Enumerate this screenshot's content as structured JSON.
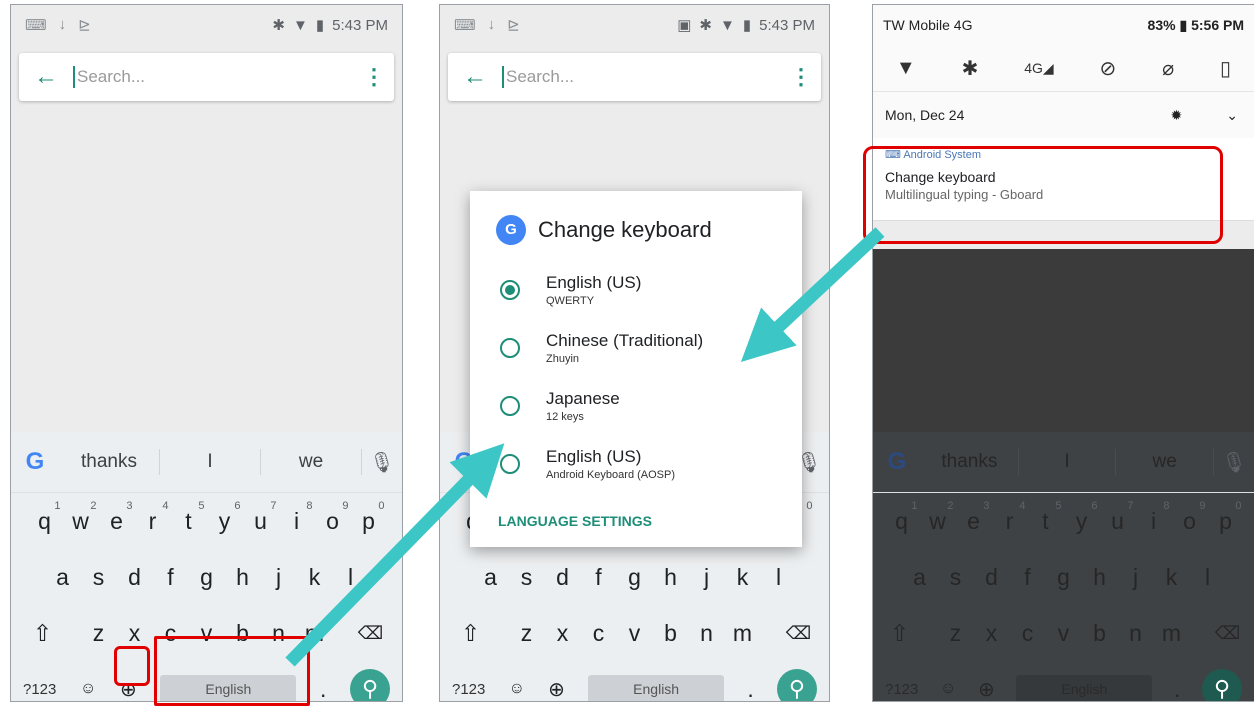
{
  "left_phone": {
    "status_time": "5:43 PM",
    "search_placeholder": "Search...",
    "suggestions": [
      "thanks",
      "I",
      "we"
    ],
    "row1": [
      [
        "q",
        "1"
      ],
      [
        "w",
        "2"
      ],
      [
        "e",
        "3"
      ],
      [
        "r",
        "4"
      ],
      [
        "t",
        "5"
      ],
      [
        "y",
        "6"
      ],
      [
        "u",
        "7"
      ],
      [
        "i",
        "8"
      ],
      [
        "o",
        "9"
      ],
      [
        "p",
        "0"
      ]
    ],
    "row2": [
      "a",
      "s",
      "d",
      "f",
      "g",
      "h",
      "j",
      "k",
      "l"
    ],
    "row3": [
      "z",
      "x",
      "c",
      "v",
      "b",
      "n",
      "m"
    ],
    "symbols_label": "?123",
    "space_label": "English"
  },
  "middle_phone": {
    "status_time": "5:43 PM",
    "search_placeholder": "Search...",
    "dialog_title": "Change keyboard",
    "options": [
      {
        "name": "English (US)",
        "detail": "QWERTY",
        "selected": true
      },
      {
        "name": "Chinese (Traditional)",
        "detail": "Zhuyin",
        "selected": false
      },
      {
        "name": "Japanese",
        "detail": "12 keys",
        "selected": false
      },
      {
        "name": "English (US)",
        "detail": "Android Keyboard (AOSP)",
        "selected": false
      }
    ],
    "settings_link": "LANGUAGE SETTINGS",
    "space_label": "English",
    "symbols_label": "?123"
  },
  "right_phone": {
    "carrier": "TW Mobile 4G",
    "battery": "83%",
    "status_time": "5:56 PM",
    "date": "Mon, Dec 24",
    "notification_source": "Android System",
    "notification_title": "Change keyboard",
    "notification_text": "Multilingual typing - Gboard",
    "suggestions": [
      "thanks",
      "I",
      "we"
    ],
    "space_label": "English",
    "symbols_label": "?123"
  },
  "colors": {
    "accent": "#1e8e78",
    "highlight": "#e00000",
    "arrow": "#3cc6c6"
  }
}
